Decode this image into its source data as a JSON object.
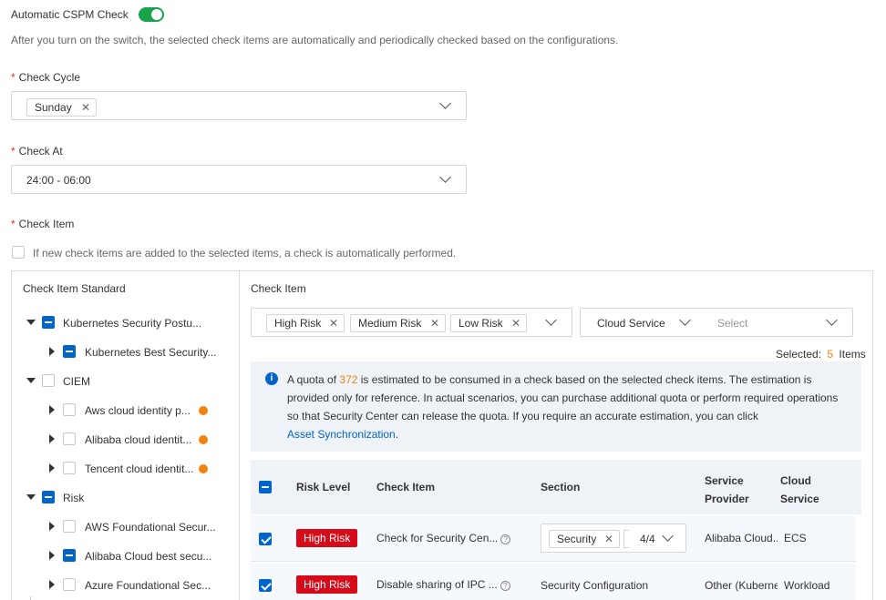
{
  "auto_check": {
    "label": "Automatic CSPM Check",
    "enabled": true,
    "description": "After you turn on the switch, the selected check items are automatically and periodically checked based on the configurations."
  },
  "check_cycle": {
    "required_mark": "*",
    "label": "Check Cycle",
    "selected_tag": "Sunday"
  },
  "check_at": {
    "required_mark": "*",
    "label": "Check At",
    "value": "24:00 - 06:00"
  },
  "check_item": {
    "required_mark": "*",
    "label": "Check Item",
    "auto_perform_text": "If new check items are added to the selected items, a check is automatically performed."
  },
  "standards_panel": {
    "title": "Check Item Standard",
    "tree": [
      {
        "label": "Kubernetes Security Postu...",
        "level": 0,
        "state": "indeterminate",
        "expanded": true
      },
      {
        "label": "Kubernetes Best Security...",
        "level": 1,
        "state": "indeterminate",
        "expanded": false
      },
      {
        "label": "CIEM",
        "level": 0,
        "state": "unchecked",
        "expanded": true
      },
      {
        "label": "Aws cloud identity p...",
        "level": 1,
        "state": "unchecked",
        "expanded": false,
        "warning": true
      },
      {
        "label": "Alibaba cloud identit...",
        "level": 1,
        "state": "unchecked",
        "expanded": false,
        "warning": true
      },
      {
        "label": "Tencent cloud identit...",
        "level": 1,
        "state": "unchecked",
        "expanded": false,
        "warning": true
      },
      {
        "label": "Risk",
        "level": 0,
        "state": "indeterminate",
        "expanded": true
      },
      {
        "label": "AWS Foundational Secur...",
        "level": 1,
        "state": "unchecked",
        "expanded": false
      },
      {
        "label": "Alibaba Cloud best secu...",
        "level": 1,
        "state": "indeterminate",
        "expanded": false
      },
      {
        "label": "Azure Foundational Sec...",
        "level": 1,
        "state": "unchecked",
        "expanded": false
      }
    ]
  },
  "items_panel": {
    "title": "Check Item",
    "risk_tags": [
      "High Risk",
      "Medium Risk",
      "Low Risk"
    ],
    "filter_type": "Cloud Service",
    "filter_placeholder": "Select",
    "selected_prefix": "Selected:",
    "selected_count": "5",
    "selected_suffix": "Items",
    "notice": {
      "text_before": "A quota of",
      "quota": "372",
      "text_after": "is estimated to be consumed in a check based on the selected check items. The estimation is provided only for reference. In actual scenarios, you can purchase additional quota or perform required operations so that Security Center can release the quota. If you require an accurate estimation, you can click",
      "link": "Asset Synchronization",
      "end": "."
    },
    "table": {
      "headers": {
        "risk_level": "Risk Level",
        "check_item": "Check Item",
        "section": "Section",
        "provider_1": "Service",
        "provider_2": "Provider",
        "cloud_1": "Cloud",
        "cloud_2": "Service"
      },
      "rows": [
        {
          "risk": "High Risk",
          "item": "Check for Security Cen...",
          "section_tag": "Security",
          "section_count": "4/4",
          "provider": "Alibaba Cloud...",
          "cloud_service": "ECS"
        },
        {
          "risk": "High Risk",
          "item": "Disable sharing of IPC ...",
          "section": "Security Configuration",
          "provider": "Other (Kuberne",
          "cloud_service": "Workload"
        }
      ]
    }
  },
  "colors": {
    "accent": "#0064c8",
    "toggle_on": "#1aa34a",
    "danger": "#d50b1a",
    "quota": "#f0820f",
    "notice_bg": "#eff3f8"
  }
}
